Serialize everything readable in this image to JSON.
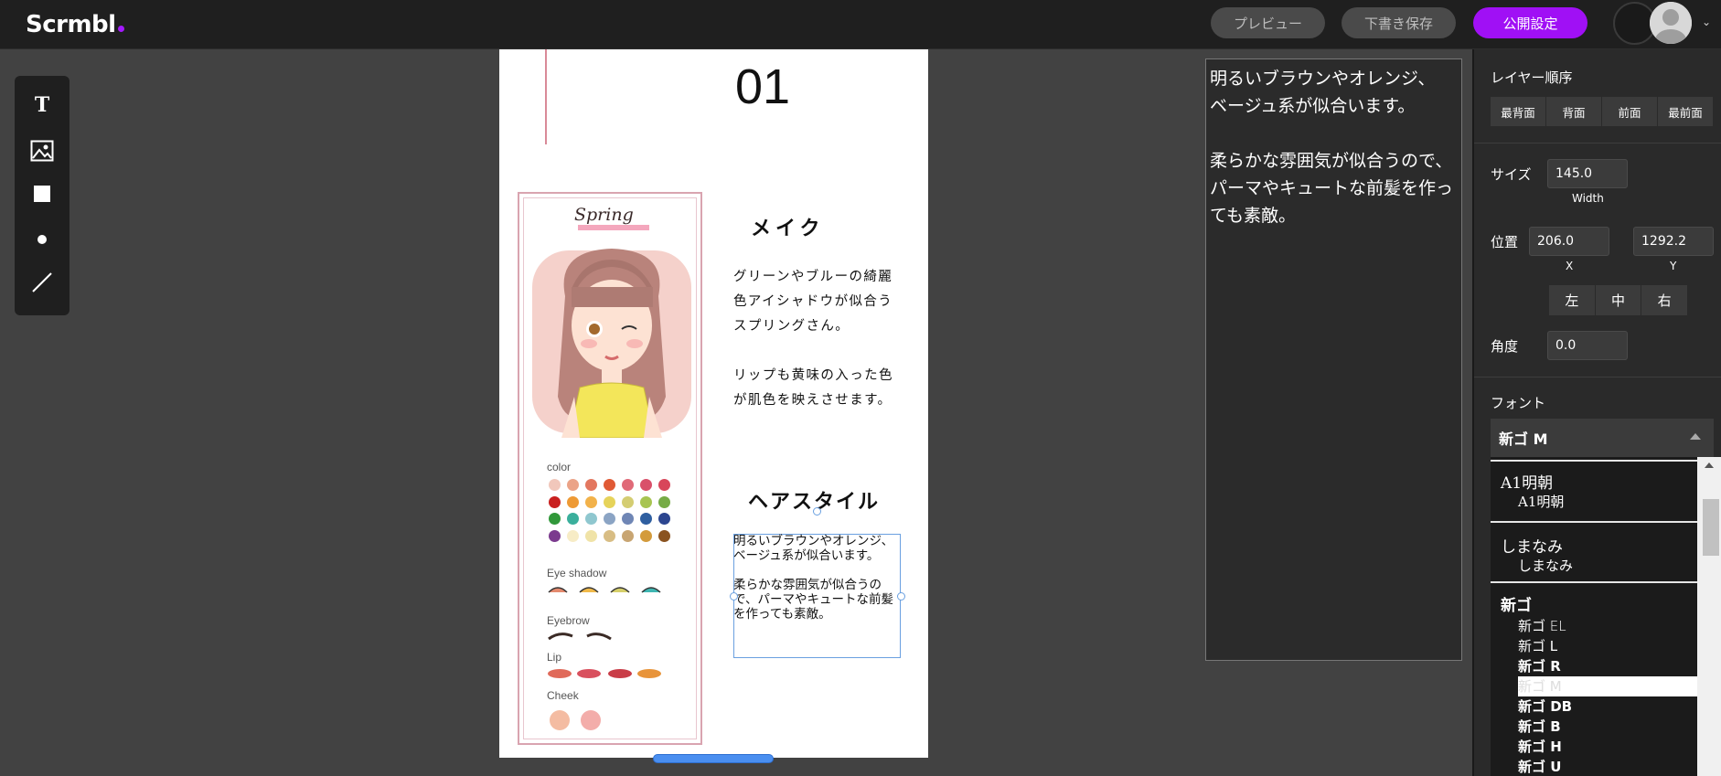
{
  "app": {
    "logo": "Scrmbl"
  },
  "topbar": {
    "preview": "プレビュー",
    "draft": "下書き保存",
    "publish": "公開設定",
    "menu_chevron": "⌄"
  },
  "colors": {
    "accent": "#a010f5",
    "selection": "#6aa0e0"
  },
  "toolbar": {
    "tools": [
      "text-tool-icon",
      "image-tool-icon",
      "rectangle-tool-icon",
      "circle-tool-icon",
      "line-tool-icon"
    ],
    "text_glyph": "T"
  },
  "page": {
    "number": "01",
    "card": {
      "title": "Spring",
      "color_label": "color",
      "eyeshadow_label": "Eye shadow",
      "eyebrow_label": "Eyebrow",
      "lip_label": "Lip",
      "cheek_label": "Cheek"
    },
    "make_heading": "メイク",
    "make_text": "グリーンやブルーの綺麗色アイシャドウが似合うスプリングさん。\n\nリップも黄味の入った色が肌色を映えさせます。",
    "hair_heading": "ヘアスタイル",
    "hair_text": "明るいブラウンやオレンジ、ベージュ系が似合います。\n\n柔らかな雰囲気が似合うので、パーマやキュートな前髪を作っても素敵。"
  },
  "editor": {
    "text": "明るいブラウンやオレンジ、\nベージュ系が似合います。\n\n柔らかな雰囲気が似合うので、パーマやキュートな前髪を作っても素敵。"
  },
  "panel": {
    "layer_order_label": "レイヤー順序",
    "layer_buttons": [
      "最背面",
      "背面",
      "前面",
      "最前面"
    ],
    "size_label": "サイズ",
    "size_value": "145.0",
    "size_sub": "Width",
    "position_label": "位置",
    "x_value": "206.0",
    "x_sub": "X",
    "y_value": "1292.2",
    "y_sub": "Y",
    "align_buttons": [
      "左",
      "中",
      "右"
    ],
    "angle_label": "角度",
    "angle_value": "0.0",
    "font_label": "フォント",
    "font_selected": "新ゴ M",
    "font_groups": [
      {
        "name": "A1明朝",
        "items": [
          "A1明朝"
        ]
      },
      {
        "name": "しまなみ",
        "items": [
          "しまなみ"
        ]
      },
      {
        "name": "新ゴ",
        "items": [
          "新ゴ EL",
          "新ゴ L",
          "新ゴ R",
          "新ゴ M",
          "新ゴ DB",
          "新ゴ B",
          "新ゴ H",
          "新ゴ U"
        ]
      }
    ]
  }
}
